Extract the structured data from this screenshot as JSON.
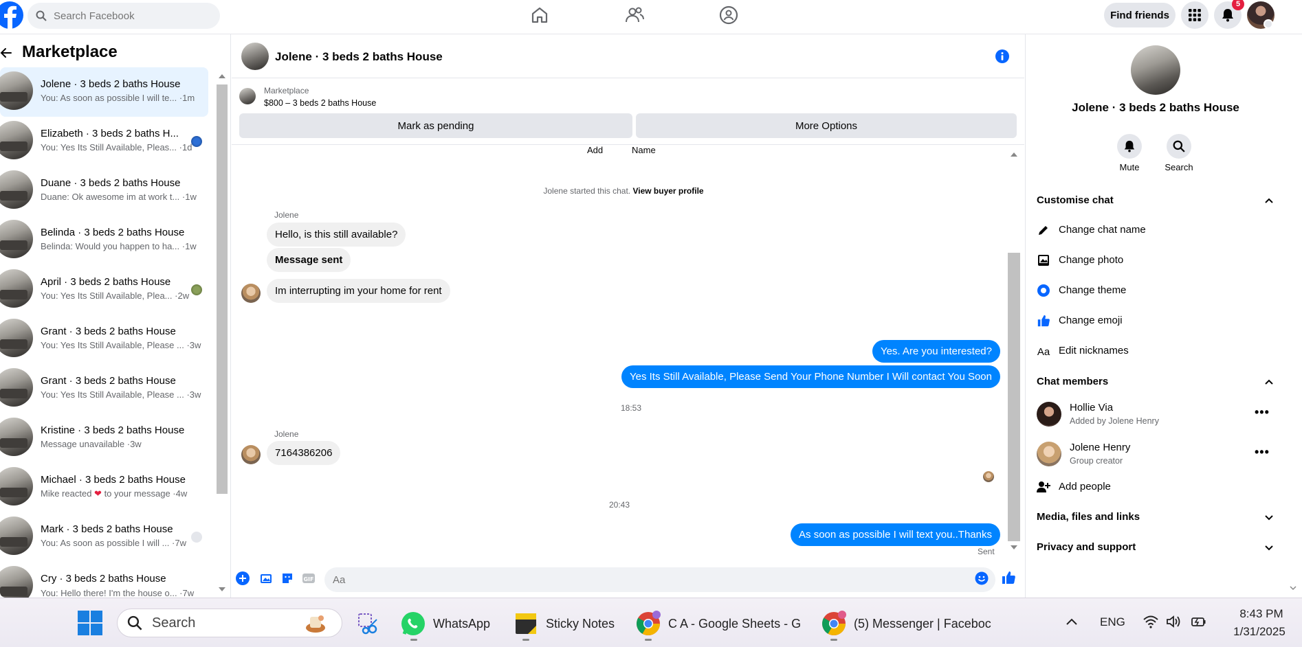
{
  "topbar": {
    "search_placeholder": "Search Facebook",
    "find_friends": "Find friends",
    "notification_count": "5"
  },
  "left": {
    "title": "Marketplace",
    "conversations": [
      {
        "title": "Jolene · 3 beds 2 baths House",
        "sub": "You: As soon as possible I will te... ·1m",
        "active": true
      },
      {
        "title": "Elizabeth · 3 beds 2 baths H...",
        "sub": "You: Yes Its Still Available, Pleas... ·1d"
      },
      {
        "title": "Duane · 3 beds 2 baths House",
        "sub": "Duane: Ok awesome im at work t... ·1w"
      },
      {
        "title": "Belinda · 3 beds 2 baths House",
        "sub": "Belinda: Would you happen to ha... ·1w"
      },
      {
        "title": "April · 3 beds 2 baths House",
        "sub": "You: Yes Its Still Available, Plea... ·2w"
      },
      {
        "title": "Grant · 3 beds 2 baths House",
        "sub": "You: Yes Its Still Available, Please ... ·3w"
      },
      {
        "title": "Grant · 3 beds 2 baths House",
        "sub": "You: Yes Its Still Available, Please ... ·3w"
      },
      {
        "title": "Kristine · 3 beds 2 baths House",
        "sub": "Message unavailable ·3w"
      },
      {
        "title": "Michael · 3 beds 2 baths House",
        "sub_a": "Mike reacted ",
        "sub_b": " to your message ·4w"
      },
      {
        "title": "Mark · 3 beds 2 baths House",
        "sub": "You: As soon as possible I will ... ·7w"
      },
      {
        "title": "Cry · 3 beds 2 baths House",
        "sub": "You: Hello there! I'm the house o... ·7w"
      }
    ]
  },
  "chat": {
    "title": "Jolene · 3 beds 2 baths House",
    "listing_label": "Marketplace",
    "listing_price": "$800 – 3 beds 2 baths House",
    "mark_pending": "Mark as pending",
    "more_options": "More Options",
    "add_label": "Add",
    "name_label": "Name",
    "started_text": "Jolene started this chat. ",
    "view_profile": "View buyer profile",
    "sender_1": "Jolene",
    "msg_1": "Hello, is this still available?",
    "msg_2": "Message sent",
    "msg_3": "Im interrupting im your home for rent",
    "out_1": "Yes. Are you interested?",
    "out_2": "Yes Its Still Available, Please Send Your Phone Number I Will contact You Soon",
    "time_1": "18:53",
    "sender_2": "Jolene",
    "msg_4": "7164386206",
    "time_2": "20:43",
    "out_3": "As soon as possible I will text you..Thanks",
    "sent_status": "Sent",
    "composer_placeholder": "Aa"
  },
  "right": {
    "title": "Jolene · 3 beds 2 baths House",
    "mute": "Mute",
    "search": "Search",
    "customise": "Customise chat",
    "change_name": "Change chat name",
    "change_photo": "Change photo",
    "change_theme": "Change theme",
    "change_emoji": "Change emoji",
    "edit_nicknames": "Edit nicknames",
    "aa_icon": "Aa",
    "members": "Chat members",
    "member_1_name": "Hollie Via",
    "member_1_sub": "Added by Jolene Henry",
    "member_2_name": "Jolene Henry",
    "member_2_sub": "Group creator",
    "add_people": "Add people",
    "media": "Media, files and links",
    "privacy": "Privacy and support"
  },
  "taskbar": {
    "search": "Search",
    "whatsapp": "WhatsApp",
    "sticky": "Sticky Notes",
    "sheets": "C A - Google Sheets - G",
    "messenger": "(5) Messenger | Faceboc",
    "lang": "ENG",
    "time": "8:43 PM",
    "date": "1/31/2025"
  },
  "colors": {
    "accent": "#0084ff",
    "brand": "#0866ff",
    "badge": "#e41e3f"
  }
}
